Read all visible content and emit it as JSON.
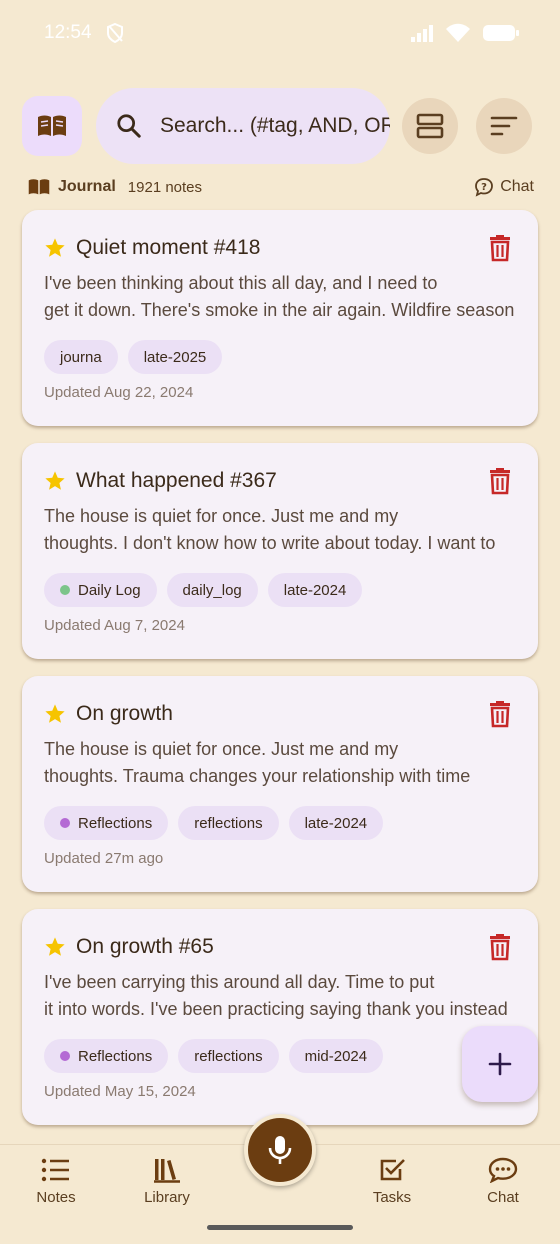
{
  "status_bar": {
    "time": "12:54"
  },
  "header": {
    "search_placeholder": "Search... (#tag, AND, OR)"
  },
  "journal": {
    "name": "Journal",
    "count": "1921 notes",
    "chat_label": "Chat"
  },
  "notes": [
    {
      "title": "Quiet moment #418",
      "line1": "I've been thinking about this all day, and I need to",
      "line2": "get it down. There's smoke in the air again. Wildfire season",
      "tags": [
        {
          "label": "journa",
          "dot": ""
        },
        {
          "label": "late-2025",
          "dot": ""
        }
      ],
      "updated": "Updated Aug 22, 2024"
    },
    {
      "title": "What happened #367",
      "line1": "The house is quiet for once. Just me and my",
      "line2": "thoughts. I don't know how to write about today. I want to",
      "tags": [
        {
          "label": "Daily Log",
          "dot": "#7cc48a"
        },
        {
          "label": "daily_log",
          "dot": ""
        },
        {
          "label": "late-2024",
          "dot": ""
        }
      ],
      "updated": "Updated Aug 7, 2024"
    },
    {
      "title": "On growth",
      "line1": "The house is quiet for once. Just me and my",
      "line2": "thoughts. Trauma changes your relationship with time",
      "tags": [
        {
          "label": "Reflections",
          "dot": "#b46ad4"
        },
        {
          "label": "reflections",
          "dot": ""
        },
        {
          "label": "late-2024",
          "dot": ""
        }
      ],
      "updated": "Updated 27m ago"
    },
    {
      "title": "On growth #65",
      "line1": "I've been carrying this around all day. Time to put",
      "line2": "it into words. I've been practicing saying thank you instead",
      "tags": [
        {
          "label": "Reflections",
          "dot": "#b46ad4"
        },
        {
          "label": "reflections",
          "dot": ""
        },
        {
          "label": "mid-2024",
          "dot": ""
        }
      ],
      "updated": "Updated May 15, 2024"
    }
  ],
  "bottom_nav": {
    "notes": "Notes",
    "library": "Library",
    "tasks": "Tasks",
    "chat": "Chat"
  },
  "colors": {
    "background": "#f5e9d1",
    "accent_brown": "#6b3d11",
    "trash_red": "#c62828",
    "star_yellow": "#f6c400",
    "fab_purple": "#ebdcfb"
  }
}
